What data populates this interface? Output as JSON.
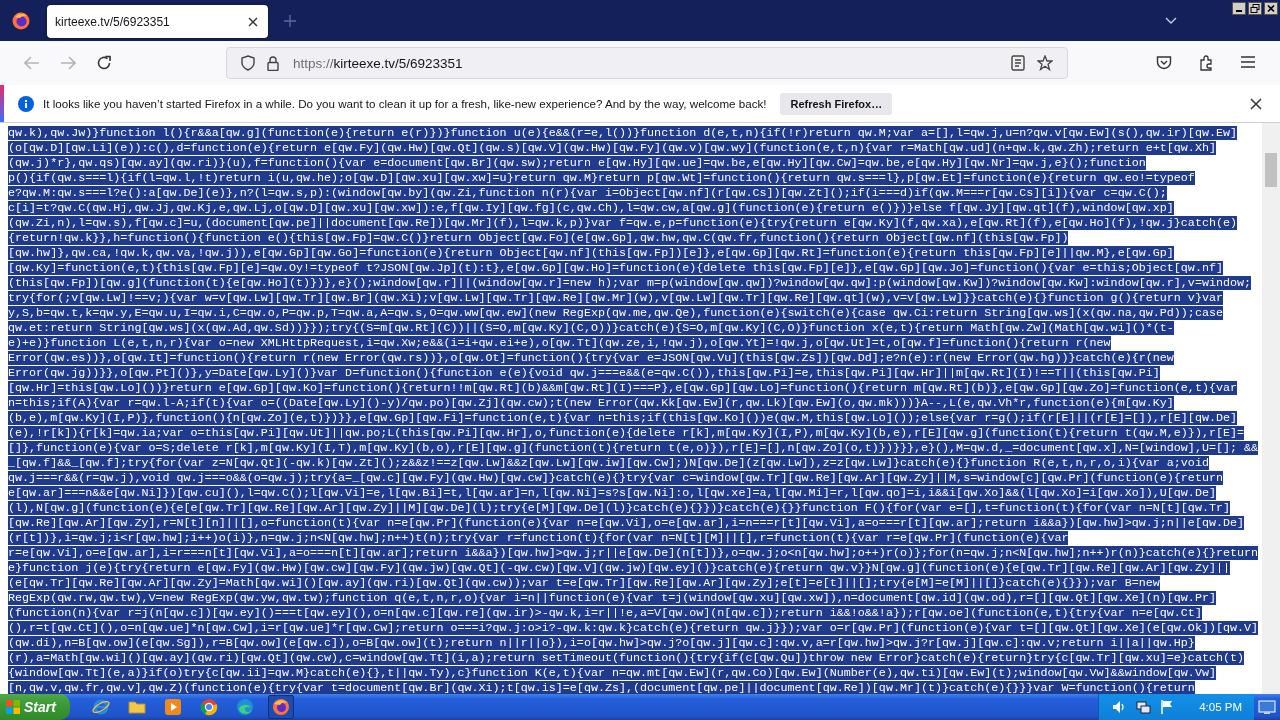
{
  "browser": {
    "tabs": [
      {
        "title": "kirteexe.tv/5/6923351",
        "selected": true
      }
    ],
    "url": {
      "scheme": "https://",
      "rest": "kirteexe.tv/5/6923351"
    },
    "notification": {
      "message": "It looks like you haven’t started Firefox in a while. Do you want to clean it up for a fresh, like-new experience? And by the way, welcome back!",
      "button": "Refresh Firefox…"
    }
  },
  "code": {
    "selected": true,
    "lines": [
      "qw.k),qw.Jw)}function l(){r&&a[qw.g](function(e){return e(r)})}function u(e){e&&(r=e,l())}function d(e,t,n){if(!r)return qw.M;var a=[],l=qw.j,u=n?qw.v[qw.Ew](s(),qw.ir)[qw.Ew]",
      "(o[qw.D][qw.Li](e)):c(),d=function(e){return e[qw.Fy](qw.Hw)[qw.Qt](qw.s)[qw.V](qw.Hw)[qw.Fy](qw.v)[qw.wy](function(e,t,n){var r=Math[qw.ud](n+qw.k,qw.Zh);return e+t[qw.Xh]",
      "(qw.j)*r},qw.qs)[qw.ay](qw.ri)}(u),f=function(){var e=document[qw.Br](qw.sw);return e[qw.Hy][qw.ue]=qw.be,e[qw.Hy][qw.Cw]=qw.be,e[qw.Hy][qw.Nr]=qw.j,e}();function",
      "p(){if(qw.s===l){if(l=qw.l,!t)return i(u,qw.he);o[qw.D][qw.xu][qw.xw]=u}return qw.M}return p[qw.Wt]=function(){return qw.s===l},p[qw.Et]=function(e){return qw.eo!=typeof",
      "e?qw.M:qw.s===l?e():a[qw.De](e)},n?(l=qw.s,p):(window[qw.by](qw.Zi,function n(r){var i=Object[qw.nf](r[qw.Cs])[qw.Zt]();if(i===d)if(qw.M===r[qw.Cs][i]){var c=qw.C();",
      "c[i]=t?qw.C(qw.Hj,qw.Jj,qw.Kj,e,qw.Lj,o[qw.D][qw.xu][qw.xw]):e,f[qw.Iy][qw.fg](c,qw.Ch),l=qw.cw,a[qw.g](function(e){return e()})}else f[qw.Jy][qw.qt](f),window[qw.xp]",
      "(qw.Zi,n),l=qw.s),f[qw.c]=u,(document[qw.pe]||document[qw.Re])[qw.Mr](f),l=qw.k,p)}var f=qw.e,p=function(e){try{return e[qw.Ky](f,qw.xa),e[qw.Rt](f),e[qw.Ho](f),!qw.j}catch(e)",
      "{return!qw.k}},h=function(){function e(){this[qw.Fp]=qw.C()}return Object[qw.Fo](e[qw.Gp],qw.hw,qw.C(qw.fr,function(){return Object[qw.nf](this[qw.Fp])",
      "[qw.hw]},qw.ca,!qw.k,qw.va,!qw.j)),e[qw.Gp][qw.Go]=function(e){return Object[qw.nf](this[qw.Fp])[e]},e[qw.Gp][qw.Rt]=function(e){return this[qw.Fp][e]||qw.M},e[qw.Gp]",
      "[qw.Ky]=function(e,t){this[qw.Fp][e]=qw.Oy!=typeof t?JSON[qw.Jp](t):t},e[qw.Gp][qw.Ho]=function(e){delete this[qw.Fp][e]},e[qw.Gp][qw.Jo]=function(){var e=this;Object[qw.nf]",
      "(this[qw.Fp])[qw.g](function(t){e[qw.Ho](t)})},e}();window[qw.r]||(window[qw.r]=new h);var m=p(window[qw.qw])?window[qw.qw]:p(window[qw.Kw])?window[qw.Kw]:window[qw.r],v=window;",
      "try{for(;v[qw.Lw]!==v;){var w=v[qw.Lw][qw.Tr][qw.Br](qw.Xi);v[qw.Lw][qw.Tr][qw.Re][qw.Mr](w),v[qw.Lw][qw.Tr][qw.Re][qw.qt](w),v=v[qw.Lw]}}catch(e){}function g(){return v}var",
      "y,S,b=qw.t,k=qw.y,E=qw.u,I=qw.i,C=qw.o,P=qw.p,T=qw.a,A=qw.s,O=qw.ww[qw.ew](new RegExp(qw.me,qw.Qe),function(e){switch(e){case qw.Ci:return String[qw.ws](x(qw.na,qw.Pd));case",
      "qw.et:return String[qw.ws](x(qw.Ad,qw.Sd))}});try{(S=m[qw.Rt](C))||(S=O,m[qw.Ky](C,O))}catch(e){S=O,m[qw.Ky](C,O)}function x(e,t){return Math[qw.Zw](Math[qw.wi]()*(t-",
      "e)+e)}function L(e,t,n,r){var o=new XMLHttpRequest,i=qw.Xw;e&&(i=i+qw.ei+e),o[qw.Tt](qw.ze,i,!qw.j),o[qw.Yt]=!qw.j,o[qw.Ut]=t,o[qw.f]=function(){return r(new",
      "Error(qw.es))},o[qw.It]=function(){return r(new Error(qw.rs))},o[qw.Ot]=function(){try{var e=JSON[qw.Vu](this[qw.Zs])[qw.Dd];e?n(e):r(new Error(qw.hg))}catch(e){r(new",
      "Error(qw.jg))}},o[qw.Pt]()},y=Date[qw.Ly]()}var D=function(){function e(e){void qw.j===e&&(e=qw.C()),this[qw.Pi]=e,this[qw.Pi][qw.Hr]||m[qw.Rt](I)!==T||(this[qw.Pi]",
      "[qw.Hr]=this[qw.Lo]())}return e[qw.Gp][qw.Ko]=function(){return!!m[qw.Rt](b)&&m[qw.Rt](I)===P},e[qw.Gp][qw.Lo]=function(){return m[qw.Rt](b)},e[qw.Gp][qw.Zo]=function(e,t){var",
      "n=this;if(A){var r=qw.l-A;if(t){var o=((Date[qw.Ly]()-y)/qw.po)[qw.Zj](qw.cw);t(new Error(qw.Kk[qw.Ew](r,qw.Lk)[qw.Ew](o,qw.mk)))}A--,L(e,qw.Vh*r,function(e){m[qw.Ky]",
      "(b,e),m[qw.Ky](I,P)},function(){n[qw.Zo](e,t)})}},e[qw.Gp][qw.Fi]=function(e,t){var n=this;if(this[qw.Ko]())e(qw.M,this[qw.Lo]());else{var r=g();if(r[E]||(r[E]=[]),r[E][qw.De]",
      "(e),!r[k]){r[k]=qw.ia;var o=this[qw.Pi][qw.Ut]||qw.po;L(this[qw.Pi][qw.Hr],o,function(e){delete r[k],m[qw.Ky](I,P),m[qw.Ky](b,e),r[E][qw.g](function(t){return t(qw.M,e)}),r[E]=",
      "[]},function(e){var o=S;delete r[k],m[qw.Ky](I,T),m[qw.Ky](b,o),r[E][qw.g](function(t){return t(e,o)}),r[E]=[],n[qw.Zo](o,t)})}}},e}(),M=qw.d,_=document[qw.x],N=[window],U=[]; &&",
      "_[qw.f]&&_[qw.f];try{for(var z=N[qw.Qt](-qw.k)[qw.Zt]();z&&z!==z[qw.Lw]&&z[qw.Lw][qw.iw][qw.Cw];)N[qw.De](z[qw.Lw]),z=z[qw.Lw]}catch(e){}function R(e,t,n,r,o,i){var a;void",
      "qw.j===r&&(r=qw.j),void qw.j===o&&(o=qw.j);try{a=_[qw.c][qw.Fy](qw.Hw)[qw.cw]}catch(e){}try{var c=window[qw.Tr][qw.Re][qw.Ar][qw.Zy]||M,s=window[c][qw.Pr](function(e){return",
      "e[qw.ar]===n&&e[qw.Ni]})[qw.cu](),l=qw.C();l[qw.Vi]=e,l[qw.Bi]=t,l[qw.ar]=n,l[qw.Ni]=s?s[qw.Ni]:o,l[qw.xe]=a,l[qw.Mi]=r,l[qw.qo]=i,i&&i[qw.Xo]&&(l[qw.Xo]=i[qw.Xo]),U[qw.De]",
      "(l),N[qw.g](function(e){e[e[qw.Tr][qw.Re][qw.Ar][qw.Zy]||M][qw.De](l);try{e[M][qw.De](l)}catch(e){}})}catch(e){}}function F(){for(var e=[],t=function(t){for(var n=N[t][qw.Tr]",
      "[qw.Re][qw.Ar][qw.Zy],r=N[t][n]||[],o=function(t){var n=e[qw.Pr](function(e){var n=e[qw.Vi],o=e[qw.ar],i=n===r[t][qw.Vi],a=o===r[t][qw.ar];return i&&a})[qw.hw]>qw.j;n||e[qw.De]",
      "(r[t])},i=qw.j;i<r[qw.hw];i++)o(i)},n=qw.j;n<N[qw.hw];n++)t(n);try{var r=function(t){for(var n=N[t][M]||[],r=function(t){var r=e[qw.Pr](function(e){var",
      "r=e[qw.Vi],o=e[qw.ar],i=r===n[t][qw.Vi],a=o===n[t][qw.ar];return i&&a})[qw.hw]>qw.j;r||e[qw.De](n[t])},o=qw.j;o<n[qw.hw];o++)r(o)};for(n=qw.j;n<N[qw.hw];n++)r(n)}catch(e){}return",
      "e}function j(e){try{return e[qw.Fy](qw.Hw)[qw.cw][qw.Fy](qw.jw)[qw.Qt](-qw.cw)[qw.V](qw.jw)[qw.ey]()}catch(e){return qw.v}}N[qw.g](function(e){e[qw.Tr][qw.Re][qw.Ar][qw.Zy]||",
      "(e[qw.Tr][qw.Re][qw.Ar][qw.Zy]=Math[qw.wi]()[qw.ay](qw.ri)[qw.Qt](qw.cw));var t=e[qw.Tr][qw.Re][qw.Ar][qw.Zy];e[t]=e[t]||[];try{e[M]=e[M]||[]}catch(e){}});var B=new",
      "RegExp(qw.rw,qw.tw),V=new RegExp(qw.yw,qw.tw);function q(e,t,n,r,o){var i=n||function(e){var t=j(window[qw.xu][qw.xw]),n=document[qw.id](qw.od),r=[][qw.Qt][qw.Xe](n)[qw.Pr]",
      "(function(n){var r=j(n[qw.c])[qw.ey]()===t[qw.ey](),o=n[qw.c][qw.re](qw.ir)>-qw.k,i=r||!e,a=V[qw.ow](n[qw.c]);return i&&!o&&!a});r[qw.oe](function(e,t){try{var n=e[qw.Ct]",
      "(),r=t[qw.Ct](),o=n[qw.ue]*n[qw.Cw],i=r[qw.ue]*r[qw.Cw];return o===i?qw.j:o>i?-qw.k:qw.k}catch(e){return qw.j}});var o=r[qw.Pr](function(e){var t=[][qw.Qt][qw.Xe](e[qw.Ok])[qw.V]",
      "(qw.di),n=B[qw.ow](e[qw.Sg]),r=B[qw.ow](e[qw.c]),o=B[qw.ow](t);return n||r||o}),i=o[qw.hw]>qw.j?o[qw.j][qw.c]:qw.v,a=r[qw.hw]>qw.j?r[qw.j][qw.c]:qw.v;return i||a||qw.Hp}",
      "(r),a=Math[qw.wi]()[qw.ay](qw.ri)[qw.Qt](qw.cw),c=window[qw.Tt](i,a);return setTimeout(function(){try{if(c[qw.Qu])throw new Error}catch(e){return}try{c[qw.Tr][qw.xu]=e}catch(t)",
      "{window[qw.Tt](e,a)}if(o)try{c[qw.ii]=qw.M}catch(e){},t||qw.Ty),c}function K(e,t){var n=qw.mt[qw.Ew](r,qw.Co)[qw.Ew](Number(e),qw.ti)[qw.Ew](t);window[qw.Vw]&&window[qw.Vw]",
      "[n,qw.v,qw.fr,qw.v],qw.Z)(function(e){try{var t=document[qw.Br](qw.Xi);t[qw.is]=e[qw.Zs],(document[qw.pe]||document[qw.Re])[qw.Mr](t)}catch(e){}}}var W=function(){return"
    ]
  },
  "taskbar": {
    "start": "Start",
    "apps": [
      {
        "kind": "ie",
        "active": false
      },
      {
        "kind": "folder",
        "active": false
      },
      {
        "kind": "media",
        "active": false
      },
      {
        "kind": "chrome",
        "active": false
      },
      {
        "kind": "edge",
        "active": false
      },
      {
        "kind": "firefox",
        "active": true
      }
    ],
    "clock": "4:05 PM"
  }
}
